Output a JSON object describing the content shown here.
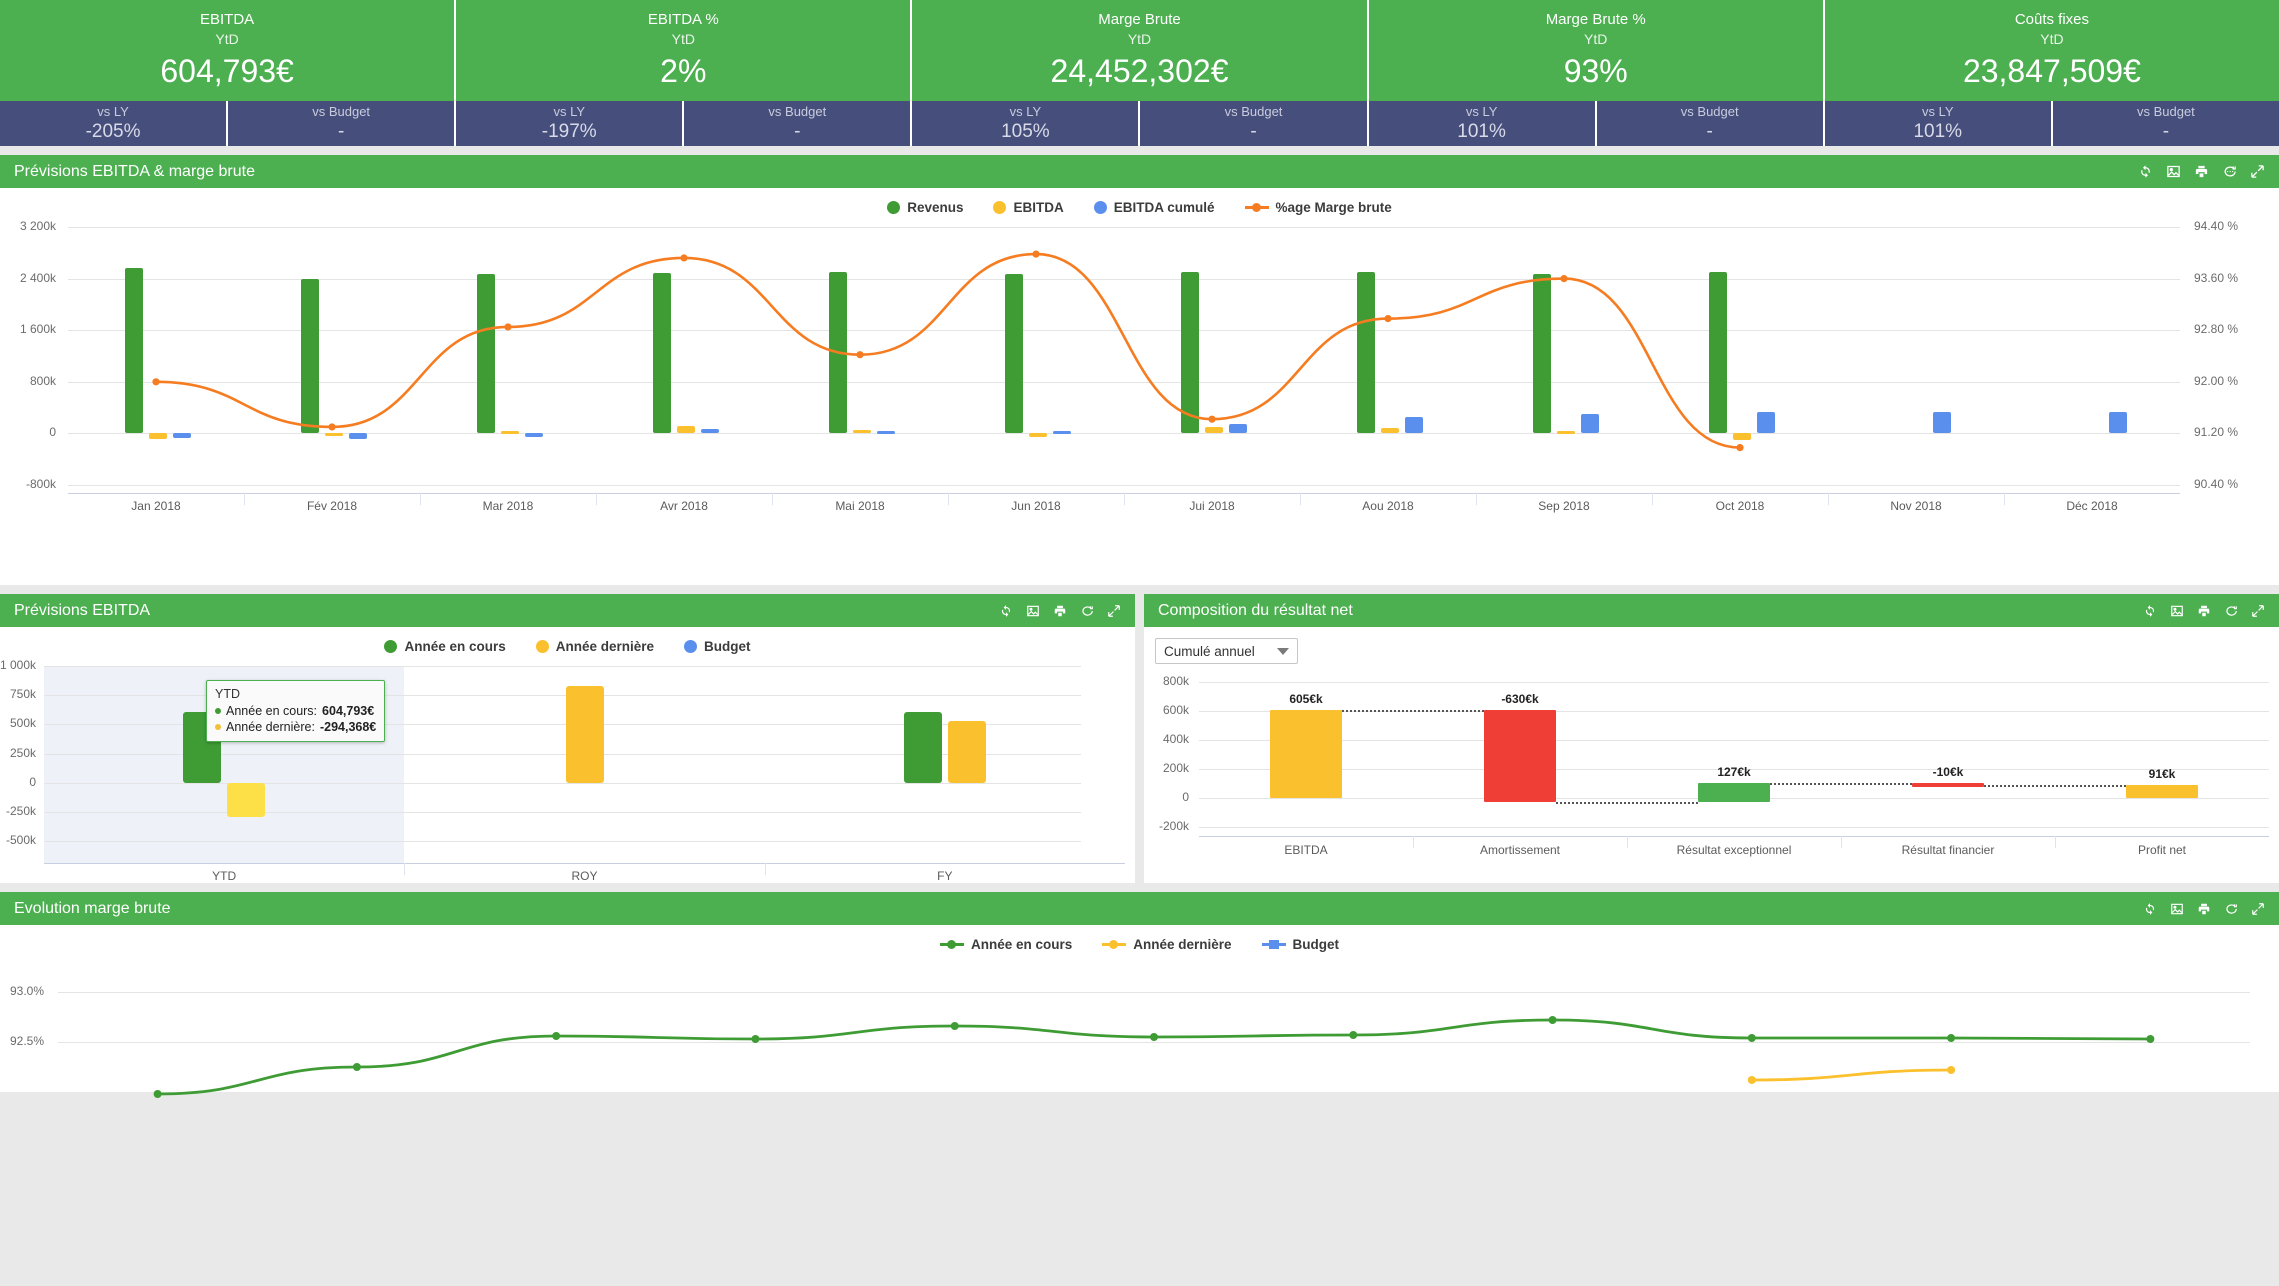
{
  "kpis": [
    {
      "title": "EBITDA",
      "sub": "YtD",
      "value": "604,793€"
    },
    {
      "title": "EBITDA %",
      "sub": "YtD",
      "value": "2%"
    },
    {
      "title": "Marge Brute",
      "sub": "YtD",
      "value": "24,452,302€"
    },
    {
      "title": "Marge Brute %",
      "sub": "YtD",
      "value": "93%"
    },
    {
      "title": "Coûts fixes",
      "sub": "YtD",
      "value": "23,847,509€"
    }
  ],
  "comparisons": [
    {
      "label": "vs LY",
      "value": "-205%"
    },
    {
      "label": "vs Budget",
      "value": "-"
    },
    {
      "label": "vs LY",
      "value": "-197%"
    },
    {
      "label": "vs Budget",
      "value": "-"
    },
    {
      "label": "vs LY",
      "value": "105%"
    },
    {
      "label": "vs Budget",
      "value": "-"
    },
    {
      "label": "vs LY",
      "value": "101%"
    },
    {
      "label": "vs Budget",
      "value": "-"
    },
    {
      "label": "vs LY",
      "value": "101%"
    },
    {
      "label": "vs Budget",
      "value": "-"
    }
  ],
  "panels": {
    "forecast": {
      "title": "Prévisions EBITDA & marge brute"
    },
    "ebitda": {
      "title": "Prévisions EBITDA"
    },
    "composition": {
      "title": "Composition du résultat net",
      "select_value": "Cumulé annuel"
    },
    "margin": {
      "title": "Evolution marge brute"
    }
  },
  "toolbar_icons": [
    "refresh-icon",
    "export-image-icon",
    "print-icon",
    "comment-icon",
    "expand-icon"
  ],
  "tooltip": {
    "title": "YTD",
    "rows": [
      {
        "name": "Année en cours:",
        "value": "604,793€",
        "color": "#3f9c35"
      },
      {
        "name": "Année dernière:",
        "value": "-294,368€",
        "color": "#f2c037"
      }
    ]
  },
  "colors": {
    "green": "#3f9c35",
    "yellow": "#fbc02d",
    "blue": "#5b8fee",
    "orange": "#f57c20",
    "red": "#ef3e36",
    "header_green": "#4caf50",
    "navy": "#464f7c"
  },
  "chart_data": [
    {
      "id": "forecast",
      "type": "bar",
      "title": "Prévisions EBITDA & marge brute",
      "xlabel": "",
      "ylabel": "",
      "categories": [
        "Jan 2018",
        "Fév 2018",
        "Mar 2018",
        "Avr 2018",
        "Mai 2018",
        "Jun 2018",
        "Jui 2018",
        "Aou 2018",
        "Sep 2018",
        "Oct 2018",
        "Nov 2018",
        "Déc 2018"
      ],
      "ylim": [
        -800000,
        3200000
      ],
      "yticks": [
        "3 200k",
        "2 400k",
        "1 600k",
        "800k",
        "0",
        "-800k"
      ],
      "y2lim": [
        90.4,
        94.4
      ],
      "y2ticks": [
        "94.40 %",
        "93.60 %",
        "92.80 %",
        "92.00 %",
        "91.20 %",
        "90.40 %"
      ],
      "legend": [
        "Revenus",
        "EBITDA",
        "EBITDA cumulé",
        "%age Marge brute"
      ],
      "legend_position": "top",
      "grid": true,
      "series": [
        {
          "name": "Revenus",
          "color": "#3f9c35",
          "type": "bar",
          "values": [
            2560000,
            2400000,
            2470000,
            2480000,
            2510000,
            2470000,
            2500000,
            2500000,
            2470000,
            2500000,
            null,
            null
          ]
        },
        {
          "name": "EBITDA",
          "color": "#fbc02d",
          "type": "bar",
          "values": [
            -90000,
            -40000,
            40000,
            120000,
            60000,
            -50000,
            100000,
            80000,
            40000,
            -110000,
            null,
            null
          ]
        },
        {
          "name": "EBITDA cumulé",
          "color": "#5b8fee",
          "type": "bar",
          "values": [
            -70000,
            -90000,
            -60000,
            70000,
            40000,
            30000,
            150000,
            260000,
            300000,
            330000,
            330000,
            330000
          ]
        },
        {
          "name": "%age Marge brute",
          "color": "#f57c20",
          "type": "line",
          "values": [
            92.0,
            91.3,
            92.85,
            93.92,
            92.42,
            93.98,
            91.42,
            92.98,
            93.6,
            90.98
          ]
        }
      ]
    },
    {
      "id": "ebitda",
      "type": "bar",
      "title": "Prévisions EBITDA",
      "categories": [
        "YTD",
        "ROY",
        "FY"
      ],
      "ylim": [
        -500000,
        1000000
      ],
      "yticks": [
        "1 000k",
        "750k",
        "500k",
        "250k",
        "0",
        "-250k",
        "-500k"
      ],
      "legend": [
        "Année en cours",
        "Année dernière",
        "Budget"
      ],
      "legend_position": "top",
      "grid": true,
      "series": [
        {
          "name": "Année en cours",
          "color": "#3f9c35",
          "values": [
            604793,
            null,
            604793
          ]
        },
        {
          "name": "Année dernière",
          "color": "#fbc02d",
          "values": [
            -294368,
            830000,
            530000
          ]
        },
        {
          "name": "Budget",
          "color": "#5b8fee",
          "values": [
            null,
            null,
            null
          ]
        }
      ]
    },
    {
      "id": "composition",
      "type": "bar",
      "title": "Composition du résultat net",
      "categories": [
        "EBITDA",
        "Amortissement",
        "Résultat exceptionnel",
        "Résultat financier",
        "Profit net"
      ],
      "ylim": [
        -200000,
        800000
      ],
      "yticks": [
        "800k",
        "600k",
        "400k",
        "200k",
        "0",
        "-200k"
      ],
      "grid": true,
      "waterfall": [
        {
          "label": "EBITDA",
          "data_label": "605€k",
          "value": 605000,
          "start": 0,
          "end": 605000,
          "color": "#fbc02d"
        },
        {
          "label": "Amortissement",
          "data_label": "-630€k",
          "value": -630000,
          "start": 605000,
          "end": -25000,
          "color": "#ef3e36"
        },
        {
          "label": "Résultat exceptionnel",
          "data_label": "127€k",
          "value": 127000,
          "start": -25000,
          "end": 102000,
          "color": "#4caf50"
        },
        {
          "label": "Résultat financier",
          "data_label": "-10€k",
          "value": -10000,
          "start": 102000,
          "end": 92000,
          "color": "#ef3e36"
        },
        {
          "label": "Profit net",
          "data_label": "91€k",
          "value": 91000,
          "start": 0,
          "end": 91000,
          "color": "#fbc02d"
        }
      ]
    },
    {
      "id": "margin",
      "type": "line",
      "title": "Evolution marge brute",
      "yticks": [
        "93.0%",
        "92.5%"
      ],
      "ylim": [
        92.0,
        93.2
      ],
      "legend": [
        "Année en cours",
        "Année dernière",
        "Budget"
      ],
      "legend_position": "top",
      "grid": true,
      "series": [
        {
          "name": "Année en cours",
          "color": "#3f9c35",
          "values": [
            91.98,
            92.25,
            92.56,
            92.53,
            92.66,
            92.55,
            92.57,
            92.72,
            92.54,
            92.54,
            92.53
          ]
        },
        {
          "name": "Année dernière",
          "color": "#fbc02d",
          "values": [
            null,
            null,
            null,
            null,
            null,
            null,
            null,
            null,
            92.12,
            92.22
          ]
        },
        {
          "name": "Budget",
          "color": "#5b8fee",
          "values": []
        }
      ]
    }
  ]
}
